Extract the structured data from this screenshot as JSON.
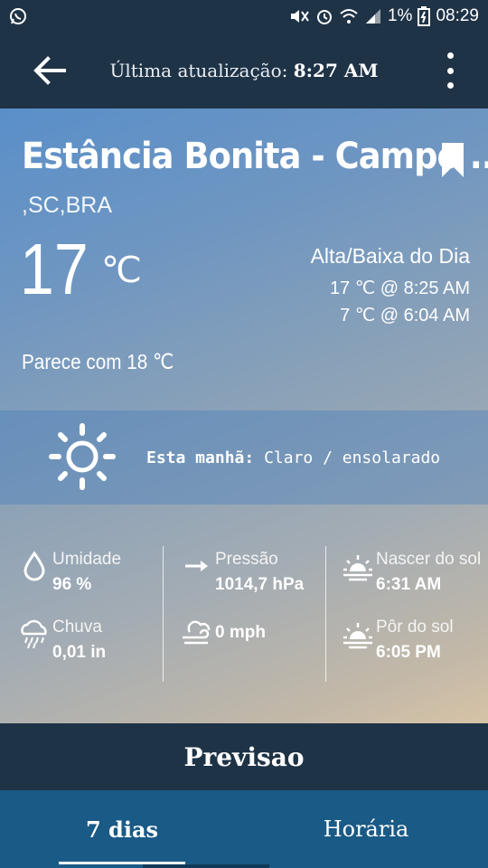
{
  "status_bar": {
    "battery_percent": "1%",
    "time": "08:29"
  },
  "header": {
    "updated_label": "Última atualização:",
    "updated_time": "8:27 AM"
  },
  "location": {
    "name": "Estância Bonita - Campo ...",
    "region": ",SC,BRA"
  },
  "current": {
    "temperature": "17",
    "unit": "℃",
    "feels_like": "Parece com 18 ℃"
  },
  "hilo": {
    "title": "Alta/Baixa do Dia",
    "high": "17 ℃ @ 8:25 AM",
    "low": "7 ℃ @ 6:04 AM"
  },
  "condition": {
    "label": "Esta manhã:",
    "text": "Claro / ensolarado",
    "icon": "sun-icon"
  },
  "details": {
    "humidity": {
      "label": "Umidade",
      "value": "96 %",
      "icon": "droplet-icon"
    },
    "rain": {
      "label": "Chuva",
      "value": "0,01 in",
      "icon": "rain-cloud-icon"
    },
    "pressure": {
      "label": "Pressão",
      "value": "1014,7 hPa",
      "icon": "arrow-right-icon"
    },
    "wind": {
      "label": "",
      "value": "0 mph",
      "icon": "wind-icon"
    },
    "sunrise": {
      "label": "Nascer do sol",
      "value": "6:31 AM",
      "icon": "sunrise-icon"
    },
    "sunset": {
      "label": "Pôr do sol",
      "value": "6:05 PM",
      "icon": "sunset-icon"
    }
  },
  "forecast": {
    "title": "Previsao",
    "tabs": [
      {
        "label": "7 dias",
        "active": true
      },
      {
        "label": "Horária",
        "active": false
      }
    ]
  }
}
